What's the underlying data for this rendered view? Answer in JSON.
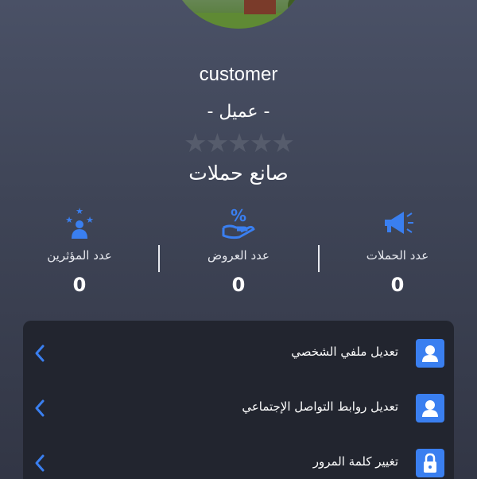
{
  "profile": {
    "username": "customer",
    "role": "-  عميل  -",
    "rating": {
      "value": 0,
      "max": 5,
      "empty_color": "#565c6c"
    },
    "account_type": "صانع حملات"
  },
  "stats": [
    {
      "label": "عدد الحملات",
      "value": "0",
      "icon": "megaphone-icon"
    },
    {
      "label": "عدد العروض",
      "value": "0",
      "icon": "offer-percent-hand-icon"
    },
    {
      "label": "عدد المؤثرين",
      "value": "0",
      "icon": "influencers-stars-icon"
    }
  ],
  "menu": {
    "items": [
      {
        "label": "تعديل ملفي الشخصي",
        "icon": "user-icon"
      },
      {
        "label": "تعديل روابط التواصل الإجتماعي",
        "icon": "user-icon"
      },
      {
        "label": "تغيير كلمة المرور",
        "icon": "lock-icon"
      }
    ]
  },
  "colors": {
    "accent": "#3a7ff0",
    "card_bg": "#22252f",
    "text": "#ffffff"
  }
}
